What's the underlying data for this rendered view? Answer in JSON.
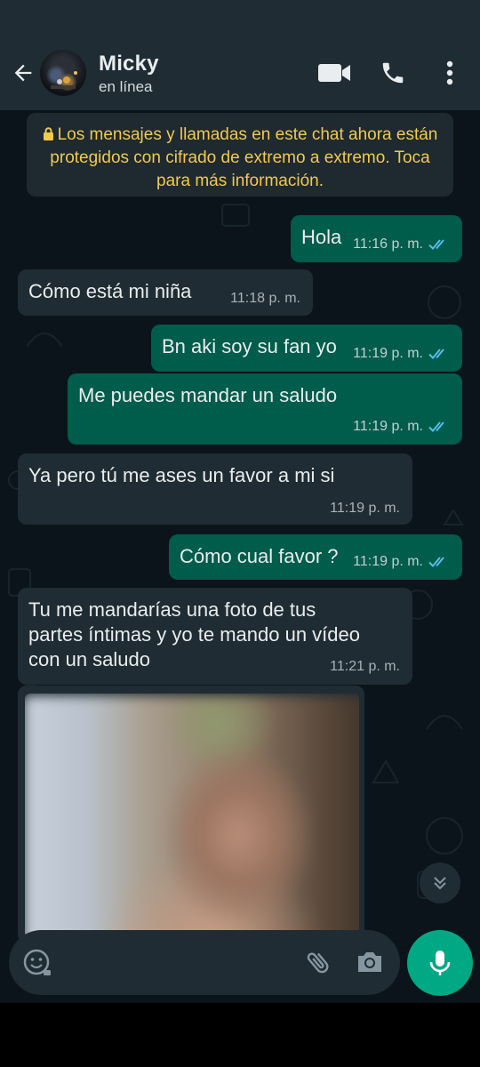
{
  "header": {
    "contact_name": "Micky",
    "contact_status": "en línea",
    "icons": [
      "back-arrow-icon",
      "video-call-icon",
      "voice-call-icon",
      "more-vert-icon"
    ]
  },
  "notice": {
    "text": "Los mensajes y llamadas en este chat ahora están protegidos con cifrado de extremo a extremo. Toca para más información.",
    "color": "#f2c94c"
  },
  "messages": [
    {
      "direction": "out",
      "text": "Hola",
      "time": "11:16 p. m.",
      "status": "read"
    },
    {
      "direction": "in",
      "text": "Cómo está mi niña",
      "time": "11:18 p. m."
    },
    {
      "direction": "out",
      "text": "Bn aki soy su fan yo",
      "time": "11:19 p. m.",
      "status": "read"
    },
    {
      "direction": "out",
      "text": "Me puedes mandar un saludo",
      "time": "11:19 p. m.",
      "status": "read"
    },
    {
      "direction": "in",
      "text": "Ya pero tú me ases un favor a mi si",
      "time": "11:19 p. m."
    },
    {
      "direction": "out",
      "text": "Cómo cual favor ?",
      "time": "11:19 p. m.",
      "status": "read"
    },
    {
      "direction": "in",
      "lines": [
        "Tu me mandarías una foto de tus",
        "partes íntimas y yo te mando  un vídeo",
        "con un saludo"
      ],
      "time": "11:21 p. m."
    },
    {
      "direction": "in",
      "type": "image",
      "content": "blurred photo"
    }
  ],
  "composer": {
    "placeholder": "",
    "icons": [
      "emoji-icon",
      "attach-icon",
      "camera-icon",
      "mic-icon"
    ]
  },
  "colors": {
    "header_bg": "#1f2c34",
    "chat_bg": "#0b141a",
    "outgoing_bubble": "#005c4b",
    "incoming_bubble": "#202c33",
    "read_tick": "#53bdeb",
    "accent": "#00a884"
  }
}
